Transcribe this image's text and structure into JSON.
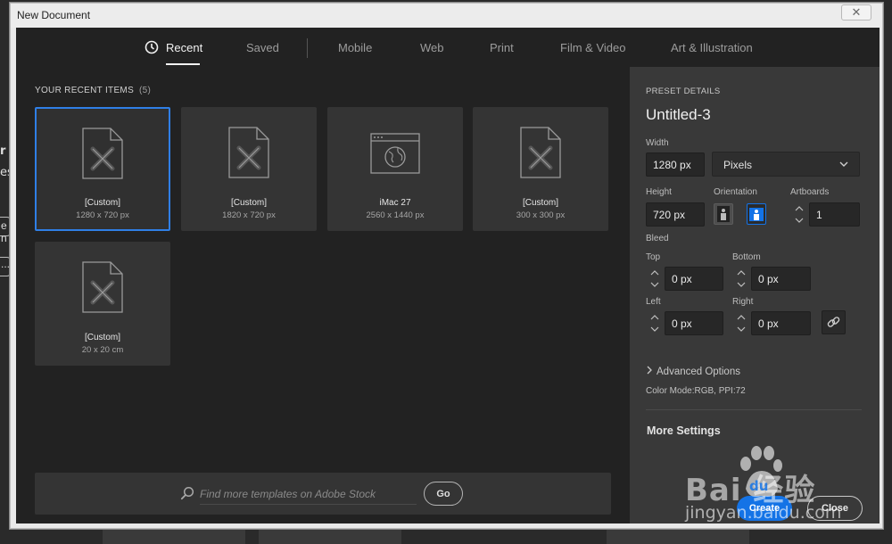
{
  "dialog": {
    "title": "New Document",
    "close_glyph": "✕"
  },
  "tabs": [
    {
      "label": "Recent",
      "active": true
    },
    {
      "label": "Saved"
    },
    {
      "label": "Mobile"
    },
    {
      "label": "Web"
    },
    {
      "label": "Print"
    },
    {
      "label": "Film & Video"
    },
    {
      "label": "Art & Illustration"
    }
  ],
  "recent": {
    "heading": "YOUR RECENT ITEMS",
    "count": "(5)",
    "items": [
      {
        "name": "[Custom]",
        "size": "1280 x 720 px",
        "icon": "document-pencil-icon",
        "selected": true
      },
      {
        "name": "[Custom]",
        "size": "1820 x 720 px",
        "icon": "document-pencil-icon"
      },
      {
        "name": "iMac 27",
        "size": "2560 x 1440 px",
        "icon": "browser-globe-icon"
      },
      {
        "name": "[Custom]",
        "size": "300 x 300 px",
        "icon": "document-pencil-icon"
      },
      {
        "name": "[Custom]",
        "size": "20 x 20 cm",
        "icon": "document-pencil-icon"
      }
    ]
  },
  "search": {
    "placeholder": "Find more templates on Adobe Stock",
    "go_label": "Go"
  },
  "preset": {
    "heading": "PRESET DETAILS",
    "name": "Untitled-3",
    "width_label": "Width",
    "width_value": "1280 px",
    "unit": "Pixels",
    "height_label": "Height",
    "height_value": "720 px",
    "orientation_label": "Orientation",
    "artboards_label": "Artboards",
    "artboards_value": "1",
    "bleed_label": "Bleed",
    "top_label": "Top",
    "top_value": "0 px",
    "bottom_label": "Bottom",
    "bottom_value": "0 px",
    "left_label": "Left",
    "left_value": "0 px",
    "right_label": "Right",
    "right_value": "0 px",
    "advanced_label": "Advanced Options",
    "color_mode": "Color Mode:RGB, PPI:72",
    "more_settings": "More Settings",
    "create_label": "Create",
    "close_label": "Close"
  },
  "background": {
    "line1": "r",
    "line2": "es",
    "line3": "e n",
    "line4": "..."
  },
  "watermark": {
    "brand": "Bai  经验",
    "paw": "du",
    "url": "jingyan.baidu.com"
  },
  "colors": {
    "accent": "#1473e6",
    "selected_border": "#2f7fe6",
    "panel_bg": "#393939",
    "body_bg": "#222222"
  }
}
